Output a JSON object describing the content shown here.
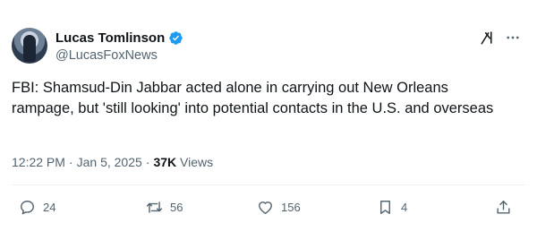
{
  "author": {
    "display_name": "Lucas Tomlinson",
    "handle": "@LucasFoxNews",
    "verified_color": "#1d9bf0"
  },
  "tweet": {
    "text": "FBI: Shamsud-Din Jabbar acted alone in carrying out New Orleans rampage, but 'still looking' into potential contacts in the U.S. and overseas",
    "time": "12:22 PM",
    "date": "Jan 5, 2025",
    "views_count": "37K",
    "views_label": "Views"
  },
  "actions": {
    "replies": "24",
    "reposts": "56",
    "likes": "156",
    "bookmarks": "4"
  },
  "icons": [
    "verified-badge-icon",
    "grok-icon",
    "more-icon",
    "reply-icon",
    "repost-icon",
    "like-icon",
    "bookmark-icon",
    "share-icon"
  ]
}
